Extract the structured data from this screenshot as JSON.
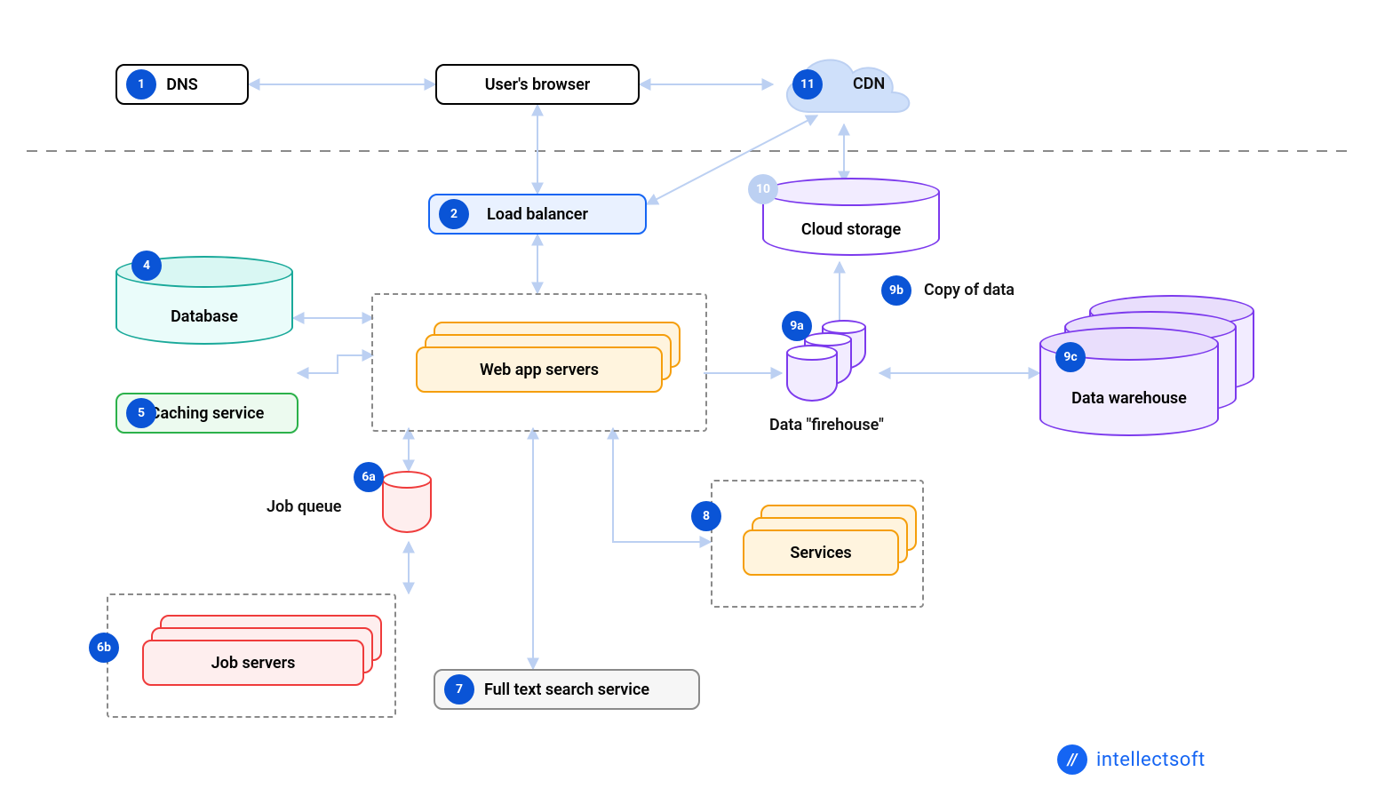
{
  "nodes": {
    "dns": "DNS",
    "browser": "User's browser",
    "cdn": "CDN",
    "load_balancer": "Load balancer",
    "database": "Database",
    "caching": "Caching service",
    "web_app": "Web app servers",
    "job_queue": "Job queue",
    "job_servers": "Job servers",
    "full_text": "Full text search service",
    "services": "Services",
    "firehouse": "Data \"firehouse\"",
    "copy_of_data": "Copy of data",
    "cloud_storage": "Cloud storage",
    "data_warehouse": "Data warehouse"
  },
  "badges": {
    "b1": "1",
    "b2": "2",
    "b4": "4",
    "b5": "5",
    "b6a": "6a",
    "b6b": "6b",
    "b7": "7",
    "b8": "8",
    "b9a": "9a",
    "b9b": "9b",
    "b9c": "9c",
    "b10": "10",
    "b11": "11"
  },
  "footer": {
    "brand": "intellectsoft"
  },
  "colors": {
    "arrow": "#bcd0f2",
    "teal": "#1aa99a",
    "green": "#2bb14a",
    "orange": "#f59e0b",
    "red": "#ef3b3b",
    "blue": "#1565f3",
    "purple": "#7c3aed",
    "grey": "#8a8a8a",
    "badge": "#0a54d6"
  }
}
